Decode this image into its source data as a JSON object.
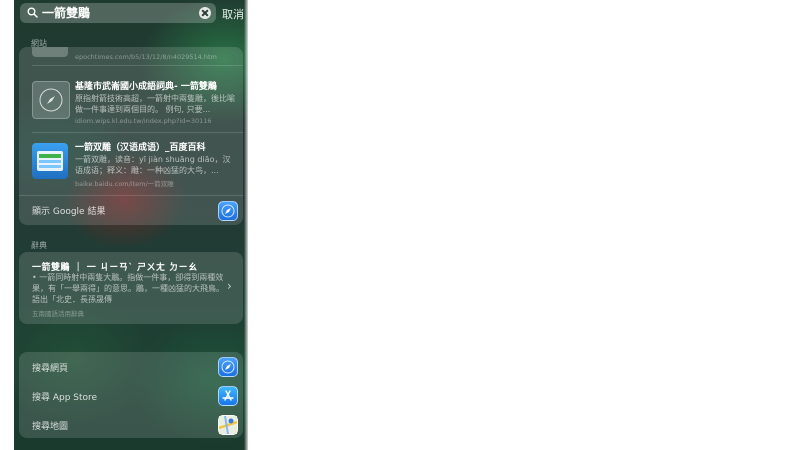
{
  "search": {
    "query": "一箭雙鵰",
    "cancel_label": "取消"
  },
  "websites": {
    "header": "網站",
    "partial_url": "epochtimes.com/b5/13/12/8/n4029514.htm",
    "items": [
      {
        "title": "基隆市武崙國小成語詞典- 一箭雙鵰",
        "description": "原指射箭技術高超，一箭射中兩隻雕，後比喻做一件事達到兩個目的。 例句, 只要...",
        "url": "idiom.wips.kl.edu.tw/index.php?id=30116"
      },
      {
        "title": "一箭双雕（汉语成语）_百度百科",
        "description": "一箭双雕，读音：yī jiàn shuāng diāo，汉语成语；释义：雕：一种凶猛的大鸟，...",
        "url": "baike.baidu.com/item/一箭双雕"
      }
    ],
    "show_google": "顯示 Google 結果"
  },
  "dictionary": {
    "header": "辭典",
    "title": "一箭雙鵰 ｜ 一 ㄐㄧㄢˋ ㄕㄨㄤ ㄉㄧㄠ",
    "description": "• 一箭同時射中兩隻大鵰。指做一件事，卻得到兩種效果，有「一舉兩得」的意思。鵰，一種凶猛的大飛鳥。語出「北史．長孫晟傳",
    "source": "五南國語活用辭典"
  },
  "search_actions": [
    {
      "label": "搜尋網頁",
      "icon": "safari-icon"
    },
    {
      "label": "搜尋 App Store",
      "icon": "app-store-icon"
    },
    {
      "label": "搜尋地圖",
      "icon": "maps-icon"
    }
  ],
  "colors": {
    "accent_blue": "#1b6fe0",
    "cancel_text": "#e6f0ea"
  }
}
